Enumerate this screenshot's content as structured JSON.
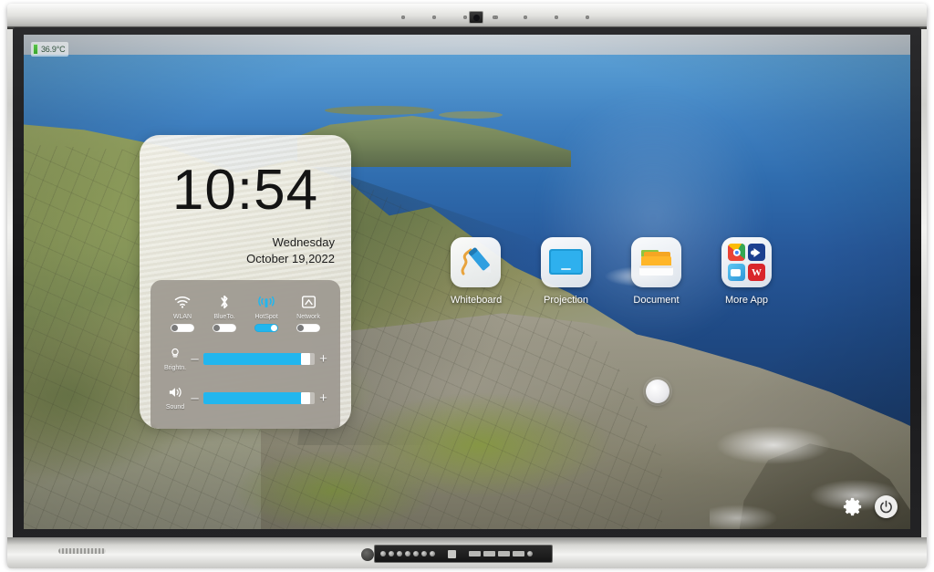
{
  "device": {
    "brand_bezel": "interactive-flat-panel",
    "camera_icon": "camera-module-icon",
    "mic_icon": "microphone-array-icon"
  },
  "status": {
    "temperature": "36.9°C",
    "temperature_icon": "thermometer-icon"
  },
  "clock_widget": {
    "time": "10:54",
    "weekday": "Wednesday",
    "date": "October 19,2022"
  },
  "control_panel": {
    "toggles": [
      {
        "label": "WLAN",
        "icon": "wifi-icon",
        "state": "off"
      },
      {
        "label": "BlueTo.",
        "icon": "bluetooth-icon",
        "state": "off"
      },
      {
        "label": "HotSpot",
        "icon": "hotspot-icon",
        "state": "on"
      },
      {
        "label": "Network",
        "icon": "ethernet-icon",
        "state": "off"
      }
    ],
    "sliders": [
      {
        "label": "Brightn.",
        "icon": "brightness-icon",
        "value": 92,
        "minus": "–",
        "plus": "+"
      },
      {
        "label": "Sound",
        "icon": "volume-icon",
        "value": 92,
        "minus": "–",
        "plus": "+"
      }
    ],
    "accent_color": "#22b6ee",
    "panel_color": "#7b746c"
  },
  "apps": [
    {
      "label": "Whiteboard",
      "icon": "whiteboard-icon"
    },
    {
      "label": "Projection",
      "icon": "projection-icon"
    },
    {
      "label": "Document",
      "icon": "document-folder-icon"
    },
    {
      "label": "More App",
      "icon": "more-app-grid-icon",
      "sub_icons": [
        "chrome-icon",
        "video-player-icon",
        "camera-app-icon",
        "wps-writer-icon"
      ]
    }
  ],
  "system_bar": {
    "home_dot": "floating-home-button",
    "settings": "gear-icon",
    "power": "power-icon"
  },
  "wallpaper": {
    "description": "aerial-coastal-cliffs",
    "sea_color": "#2f6cae",
    "land_color": "#8b9a5b"
  }
}
